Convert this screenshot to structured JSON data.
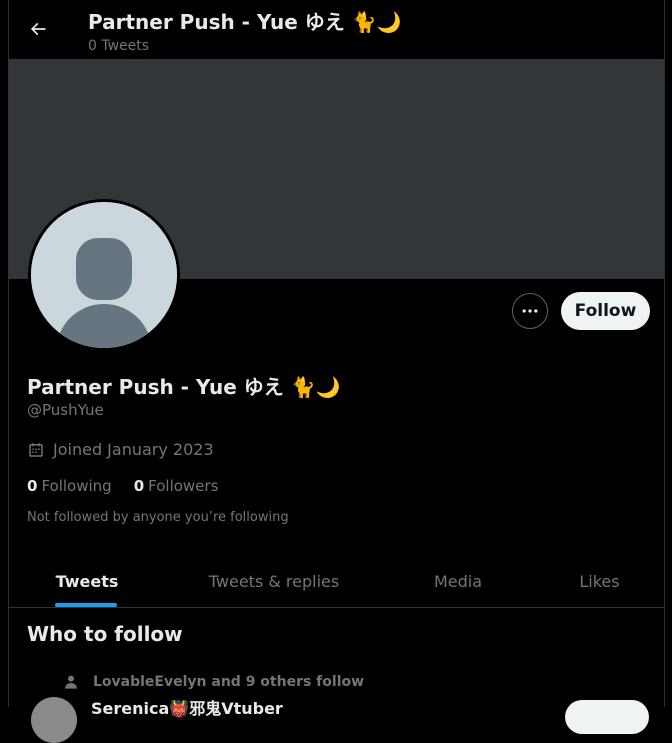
{
  "header": {
    "title": "Partner Push - Yue ゆえ 🐈🌙",
    "tweet_count": "0 Tweets"
  },
  "profile": {
    "name": "Partner Push - Yue ゆえ 🐈🌙",
    "handle": "@PushYue",
    "joined": "Joined January 2023",
    "following_count": "0",
    "following_label": "Following",
    "followers_count": "0",
    "followers_label": "Followers",
    "not_followed": "Not followed by anyone you’re following",
    "follow_label": "Follow"
  },
  "tabs": [
    {
      "label": "Tweets",
      "active": true
    },
    {
      "label": "Tweets & replies",
      "active": false
    },
    {
      "label": "Media",
      "active": false
    },
    {
      "label": "Likes",
      "active": false
    }
  ],
  "who_to_follow": {
    "title": "Who to follow",
    "social_context": "LovableEvelyn and 9 others follow",
    "suggestion_name": "Serenica👹邪鬼Vtuber"
  },
  "icons": {
    "back": "arrow-left-icon",
    "more": "more-horizontal-icon",
    "calendar": "calendar-icon",
    "person": "person-icon"
  },
  "colors": {
    "background": "#000000",
    "banner": "#333639",
    "accent": "#1d9bf0",
    "muted_text": "#71767b",
    "primary_text": "#e7e9ea"
  }
}
